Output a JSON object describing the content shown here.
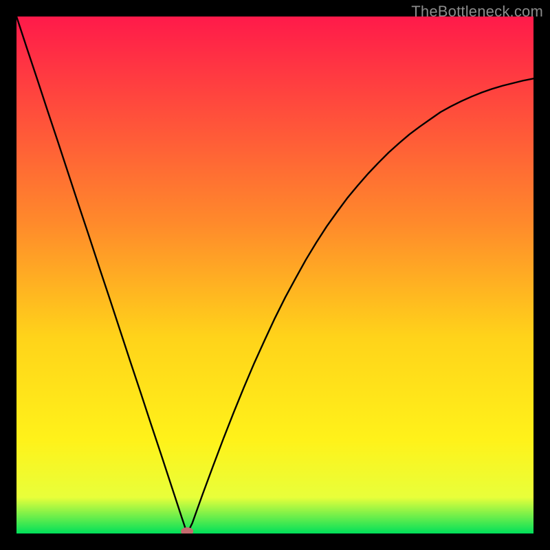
{
  "watermark": "TheBottleneck.com",
  "chart_data": {
    "type": "line",
    "title": "",
    "xlabel": "",
    "ylabel": "",
    "xlim": [
      0,
      1
    ],
    "ylim": [
      0,
      1
    ],
    "x": [
      0.0,
      0.02,
      0.04,
      0.06,
      0.08,
      0.1,
      0.12,
      0.14,
      0.16,
      0.18,
      0.2,
      0.22,
      0.24,
      0.26,
      0.28,
      0.3,
      0.32,
      0.33,
      0.34,
      0.35,
      0.36,
      0.38,
      0.4,
      0.42,
      0.44,
      0.46,
      0.48,
      0.5,
      0.52,
      0.54,
      0.56,
      0.58,
      0.6,
      0.62,
      0.64,
      0.66,
      0.68,
      0.7,
      0.72,
      0.74,
      0.76,
      0.78,
      0.8,
      0.82,
      0.84,
      0.86,
      0.88,
      0.9,
      0.92,
      0.94,
      0.96,
      0.98,
      1.0
    ],
    "values": [
      1.0,
      0.939,
      0.879,
      0.818,
      0.758,
      0.697,
      0.636,
      0.576,
      0.515,
      0.455,
      0.394,
      0.333,
      0.273,
      0.212,
      0.152,
      0.091,
      0.03,
      0.0,
      0.02,
      0.048,
      0.076,
      0.13,
      0.183,
      0.234,
      0.283,
      0.33,
      0.374,
      0.417,
      0.457,
      0.494,
      0.53,
      0.563,
      0.594,
      0.622,
      0.649,
      0.673,
      0.696,
      0.717,
      0.737,
      0.755,
      0.772,
      0.787,
      0.801,
      0.815,
      0.826,
      0.836,
      0.845,
      0.853,
      0.86,
      0.866,
      0.871,
      0.876,
      0.88
    ],
    "minimum_x": 0.33,
    "gradient_colors": {
      "top": "#ff1a4a",
      "mid_upper": "#ff8a2b",
      "mid": "#ffd31a",
      "mid_lower": "#fff21a",
      "lower": "#e8ff3a",
      "bottom": "#00e05a"
    },
    "curve_color": "#000000",
    "marker_color": "#c46a6e"
  }
}
